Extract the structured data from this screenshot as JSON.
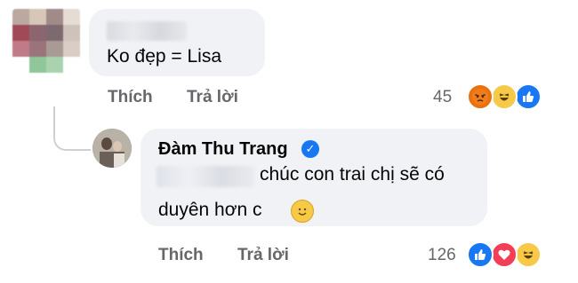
{
  "comment1": {
    "text": "Ko đẹp = Lisa",
    "actions": {
      "like": "Thích",
      "reply": "Trả lời"
    },
    "reaction_count": "45",
    "reactions": [
      "angry-icon",
      "haha-icon",
      "like-icon"
    ]
  },
  "reply1": {
    "author": "Đàm Thu Trang",
    "line1": "chúc con trai chị sẽ có",
    "line2": "duyên hơn c",
    "actions": {
      "like": "Thích",
      "reply": "Trả lời"
    },
    "reaction_count": "126",
    "reactions": [
      "like-icon",
      "love-icon",
      "haha-icon"
    ]
  },
  "colors": {
    "bubble": "#f0f2f5",
    "like_blue": "#1877f2",
    "love_red": "#f33e58",
    "emoji_yellow": "#f7c948",
    "angry_orange": "#e9710f",
    "meta_gray": "#65676b"
  }
}
